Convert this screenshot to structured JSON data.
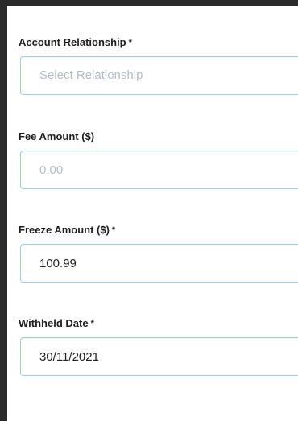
{
  "form": {
    "account_relationship": {
      "label": "Account Relationship",
      "required_marker": "*",
      "placeholder": "Select Relationship",
      "value": ""
    },
    "fee_amount": {
      "label": "Fee Amount ($)",
      "placeholder": "0.00",
      "value": ""
    },
    "freeze_amount": {
      "label": "Freeze Amount ($)",
      "required_marker": "*",
      "value": "100.99"
    },
    "withheld_date": {
      "label": "Withheld Date",
      "required_marker": "*",
      "value": "30/11/2021"
    }
  }
}
